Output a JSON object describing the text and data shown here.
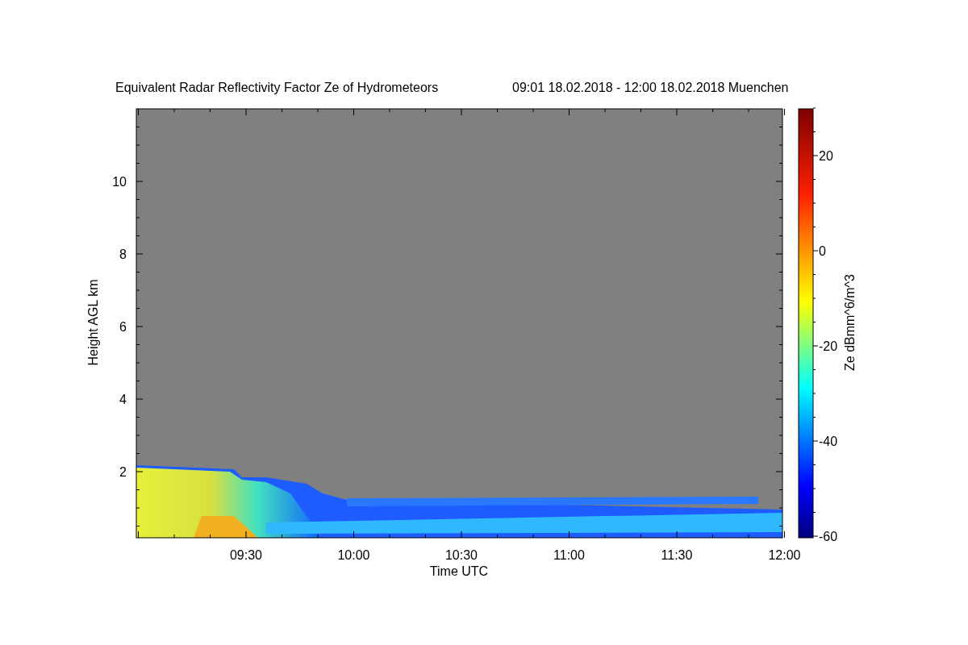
{
  "title": {
    "main": "Equivalent Radar Reflectivity Factor Ze of Hydrometeors",
    "period": "09:01 18.02.2018 - 12:00 18.02.2018 Muenchen"
  },
  "x_axis": {
    "label": "Time UTC",
    "ticks": [
      "09:30",
      "10:00",
      "10:30",
      "11:00",
      "11:30",
      "12:00"
    ]
  },
  "y_axis": {
    "label": "Height AGL km",
    "ticks": [
      "10",
      "8",
      "6",
      "4",
      "2"
    ]
  },
  "colorbar": {
    "label": "Ze dBmm^6/m^3",
    "ticks": [
      "20",
      "0",
      "-20",
      "-40",
      "-60"
    ]
  }
}
